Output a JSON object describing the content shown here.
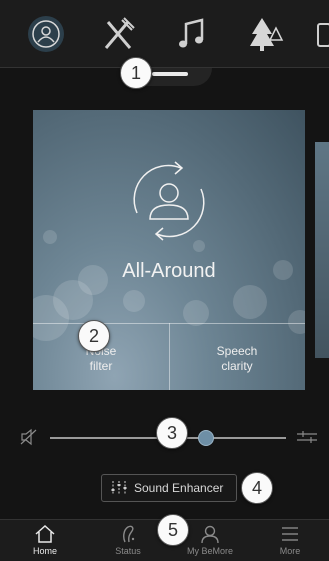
{
  "programs": [
    {
      "icon": "all-around-icon",
      "active": true
    },
    {
      "icon": "restaurant-icon",
      "active": false
    },
    {
      "icon": "music-icon",
      "active": false
    },
    {
      "icon": "outdoor-icon",
      "active": false
    },
    {
      "icon": "partial-program-icon",
      "active": false
    }
  ],
  "card": {
    "program_name": "All-Around",
    "feature_left": "Noise\nfilter",
    "feature_right": "Speech\nclarity"
  },
  "volume": {
    "level_fraction": 0.66
  },
  "enhancer": {
    "label": "Sound Enhancer"
  },
  "callouts": [
    "1",
    "2",
    "3",
    "4",
    "5"
  ],
  "nav": [
    {
      "label": "Home",
      "icon": "home-icon",
      "active": true
    },
    {
      "label": "Status",
      "icon": "hearing-aid-icon",
      "active": false
    },
    {
      "label": "My BeMore",
      "icon": "person-icon",
      "active": false
    },
    {
      "label": "More",
      "icon": "menu-icon",
      "active": false
    }
  ],
  "colors": {
    "accent": "#6e8fa6",
    "background": "#141414",
    "bar": "#1c1c1c"
  }
}
